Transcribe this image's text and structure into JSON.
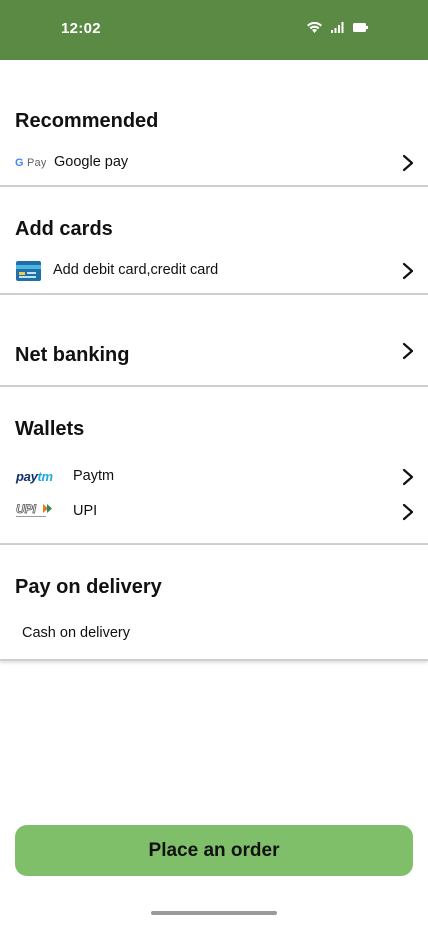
{
  "status_bar": {
    "time": "12:02",
    "icons": [
      "wifi-icon",
      "signal-icon",
      "battery-icon"
    ],
    "color": "#5a8a44"
  },
  "recommended": {
    "title": "Recommended",
    "items": [
      {
        "label": "Google pay",
        "logo": "G Pay"
      }
    ]
  },
  "cards": {
    "title": "Add cards",
    "items": [
      {
        "label": "Add debit card,credit card",
        "icon": "credit-card-icon"
      }
    ]
  },
  "net_banking": {
    "title": "Net banking"
  },
  "wallets": {
    "title": "Wallets",
    "items": [
      {
        "label": "Paytm",
        "logo": "paytm"
      },
      {
        "label": "UPI",
        "logo": "UPI"
      }
    ]
  },
  "pay_on_delivery": {
    "title": "Pay on delivery",
    "items": [
      {
        "label": "Cash on delivery"
      }
    ]
  },
  "order_button": {
    "label": "Place an order",
    "color": "#7fbf6a"
  }
}
